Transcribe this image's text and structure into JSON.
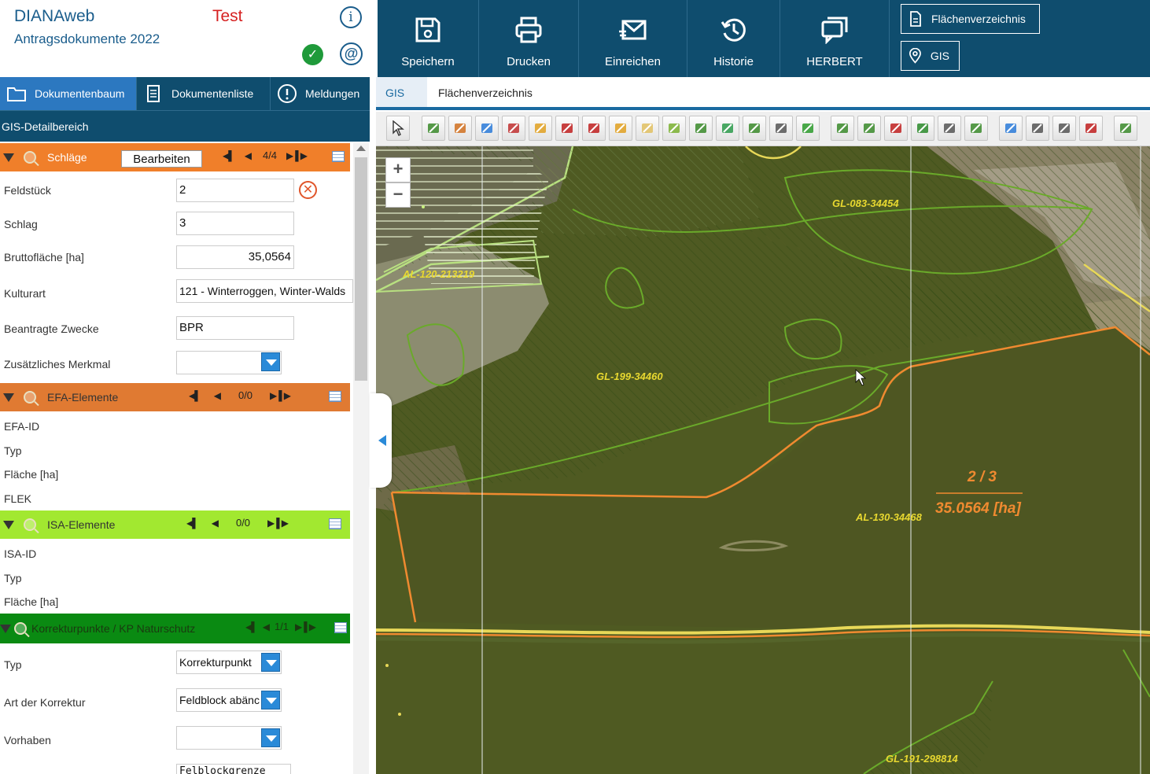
{
  "app": {
    "title": "DIANAweb",
    "subtitle": "Antragsdokumente 2022",
    "env": "Test"
  },
  "tabs": [
    {
      "label": "Dokumentenbaum",
      "icon": "folder-icon",
      "active": true
    },
    {
      "label": "Dokumentenliste",
      "icon": "document-list-icon",
      "active": false
    },
    {
      "label": "Meldungen",
      "icon": "exclamation-icon",
      "active": false
    }
  ],
  "detail_header": "GIS-Detailbereich",
  "sections": {
    "schlaege": {
      "name": "Schläge",
      "edit_label": "Bearbeiten",
      "counter": "4/4",
      "color": "#f07f2a"
    },
    "efa": {
      "name": "EFA-Elemente",
      "counter": "0/0",
      "color": "#e07a32"
    },
    "isa": {
      "name": "ISA-Elemente",
      "counter": "0/0",
      "color": "#a2e830"
    },
    "kp": {
      "name": "Korrekturpunkte / KP Naturschutz",
      "counter": "1/1",
      "color": "#0a8a12"
    }
  },
  "schlag_fields": {
    "feldstueck_label": "Feldstück",
    "feldstueck_value": "2",
    "schlag_label": "Schlag",
    "schlag_value": "3",
    "brutto_label": "Bruttofläche [ha]",
    "brutto_value": "35,0564",
    "kulturart_label": "Kulturart",
    "kulturart_value": "121 - Winterroggen, Winter-Walds",
    "zwecke_label": "Beantragte Zwecke",
    "zwecke_value": "BPR",
    "merkmal_label": "Zusätzliches Merkmal",
    "merkmal_value": ""
  },
  "efa_fields": [
    "EFA-ID",
    "Typ",
    "Fläche [ha]",
    "FLEK"
  ],
  "isa_fields": [
    "ISA-ID",
    "Typ",
    "Fläche [ha]"
  ],
  "kp_fields": {
    "typ_label": "Typ",
    "typ_value": "Korrekturpunkt",
    "art_label": "Art der Korrektur",
    "art_value": "Feldblock abänc",
    "vorhaben_label": "Vorhaben",
    "vorhaben_value": "",
    "extra_value": "Felblockgrenze"
  },
  "topbar": {
    "buttons": [
      {
        "label": "Speichern",
        "icon": "save-icon"
      },
      {
        "label": "Drucken",
        "icon": "print-icon"
      },
      {
        "label": "Einreichen",
        "icon": "submit-mail-icon"
      },
      {
        "label": "Historie",
        "icon": "history-icon"
      },
      {
        "label": "HERBERT",
        "icon": "chat-icon"
      }
    ],
    "outline_buttons": [
      {
        "label": "Flächenverzeichnis",
        "icon": "document-icon"
      },
      {
        "label": "GIS",
        "icon": "location-pin-icon"
      }
    ]
  },
  "subtabs": [
    {
      "label": "GIS",
      "active": true
    },
    {
      "label": "Flächenverzeichnis",
      "active": false
    }
  ],
  "map": {
    "labels": [
      "GL-083-34454",
      "AL-120-213219",
      "GL-199-34460",
      "AL-130-34468",
      "GL-191-298814"
    ],
    "selection_index": "2 / 3",
    "selection_area": "35.0564 [ha]",
    "zoom_in": "+",
    "zoom_out": "−"
  }
}
